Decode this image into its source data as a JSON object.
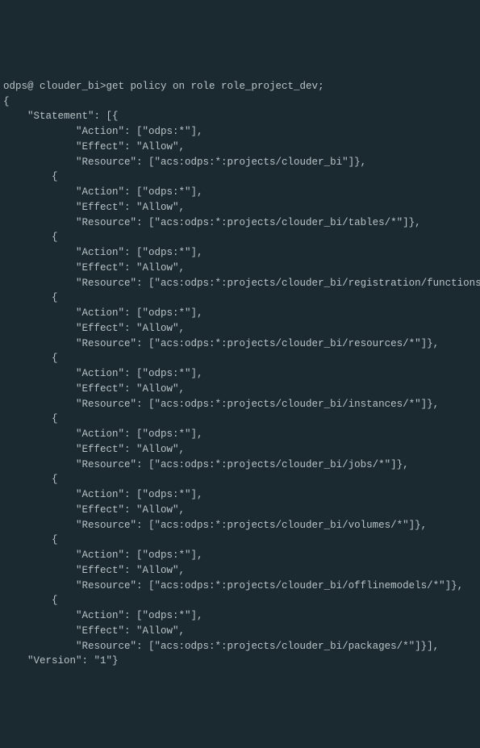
{
  "prompt_line": "odps@ clouder_bi>get policy on role role_project_dev;",
  "open_brace": "{",
  "statement_open": "    \"Statement\": [{",
  "statements": [
    {
      "action": "            \"Action\": [\"odps:*\"],",
      "effect": "            \"Effect\": \"Allow\",",
      "resource": "            \"Resource\": [\"acs:odps:*:projects/clouder_bi\"]},"
    },
    {
      "open": "        {",
      "action": "            \"Action\": [\"odps:*\"],",
      "effect": "            \"Effect\": \"Allow\",",
      "resource": "            \"Resource\": [\"acs:odps:*:projects/clouder_bi/tables/*\"]},"
    },
    {
      "open": "        {",
      "action": "            \"Action\": [\"odps:*\"],",
      "effect": "            \"Effect\": \"Allow\",",
      "resource": "            \"Resource\": [\"acs:odps:*:projects/clouder_bi/registration/functions/*\"]},"
    },
    {
      "open": "        {",
      "action": "            \"Action\": [\"odps:*\"],",
      "effect": "            \"Effect\": \"Allow\",",
      "resource": "            \"Resource\": [\"acs:odps:*:projects/clouder_bi/resources/*\"]},"
    },
    {
      "open": "        {",
      "action": "            \"Action\": [\"odps:*\"],",
      "effect": "            \"Effect\": \"Allow\",",
      "resource": "            \"Resource\": [\"acs:odps:*:projects/clouder_bi/instances/*\"]},"
    },
    {
      "open": "        {",
      "action": "            \"Action\": [\"odps:*\"],",
      "effect": "            \"Effect\": \"Allow\",",
      "resource": "            \"Resource\": [\"acs:odps:*:projects/clouder_bi/jobs/*\"]},"
    },
    {
      "open": "        {",
      "action": "            \"Action\": [\"odps:*\"],",
      "effect": "            \"Effect\": \"Allow\",",
      "resource": "            \"Resource\": [\"acs:odps:*:projects/clouder_bi/volumes/*\"]},"
    },
    {
      "open": "        {",
      "action": "            \"Action\": [\"odps:*\"],",
      "effect": "            \"Effect\": \"Allow\",",
      "resource": "            \"Resource\": [\"acs:odps:*:projects/clouder_bi/offlinemodels/*\"]},"
    },
    {
      "open": "        {",
      "action": "            \"Action\": [\"odps:*\"],",
      "effect": "            \"Effect\": \"Allow\",",
      "resource": "            \"Resource\": [\"acs:odps:*:projects/clouder_bi/packages/*\"]}],"
    }
  ],
  "version_line": "    \"Version\": \"1\"}"
}
